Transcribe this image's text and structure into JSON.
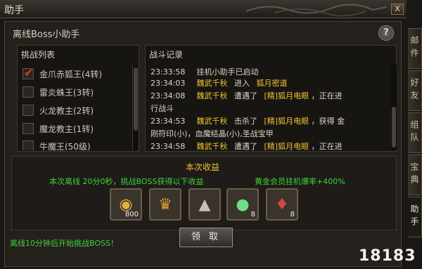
{
  "window": {
    "title": "助手",
    "close_label": "X"
  },
  "panel": {
    "title": "离线Boss小助手",
    "help_label": "?"
  },
  "challenge_list": {
    "header": "挑战列表",
    "items": [
      {
        "label": "金爪赤狐王(4转)",
        "checked": true
      },
      {
        "label": "雷炎蛛王(3转)",
        "checked": false
      },
      {
        "label": "火龙教主(2转)",
        "checked": false
      },
      {
        "label": "魔龙教主(1转)",
        "checked": false
      },
      {
        "label": "牛魔王(50级)",
        "checked": false
      }
    ]
  },
  "battle_log": {
    "header": "战斗记录",
    "lines": [
      {
        "time": "23:33:58",
        "parts": [
          "挂机小助手已启动"
        ]
      },
      {
        "time": "23:34:03",
        "player": "魏武千秋",
        "action": "进入",
        "target": "狐月密道",
        "rest": ""
      },
      {
        "time": "23:34:08",
        "player": "魏武千秋",
        "action": "遭遇了",
        "target": "[精]狐月电眼",
        "rest": "，正在进"
      },
      {
        "time": "",
        "cont": "行战斗"
      },
      {
        "time": "23:34:53",
        "player": "魏武千秋",
        "action": "击杀了",
        "target": "[精]狐月电眼",
        "rest": "，获得 金"
      },
      {
        "time": "",
        "cont": "刚符印(小)，血魔结晶(小),圣战宝甲"
      },
      {
        "time": "23:34:58",
        "player": "魏武千秋",
        "action": "遭遇了",
        "target": "[精]狐月电眼",
        "rest": "，正在进"
      }
    ]
  },
  "earnings": {
    "header": "本次收益",
    "offline_text": "本次离线 20分0秒，挑战BOSS获得以下收益",
    "vip_text": "黄金会员挂机爆率+400%",
    "items": [
      {
        "icon": "gold-coin-icon",
        "glyph": "🪙",
        "count": "800"
      },
      {
        "icon": "golden-helmet-icon",
        "glyph": "⛑",
        "count": ""
      },
      {
        "icon": "spiked-armor-icon",
        "glyph": "⚜",
        "count": ""
      },
      {
        "icon": "green-orb-icon",
        "glyph": "●",
        "count": "8"
      },
      {
        "icon": "red-crystal-icon",
        "glyph": "♦",
        "count": "8"
      }
    ],
    "claim_label": "领 取"
  },
  "footer_note": "离线10分钟后开始挑战BOSS！",
  "side_tabs": [
    "邮件",
    "好友",
    "组队",
    "宝典",
    "助手"
  ],
  "watermark": "18183",
  "colors": {
    "highlight_yellow": "#f0c232",
    "green_text": "#3fd23a",
    "check_red": "#e0382c"
  }
}
